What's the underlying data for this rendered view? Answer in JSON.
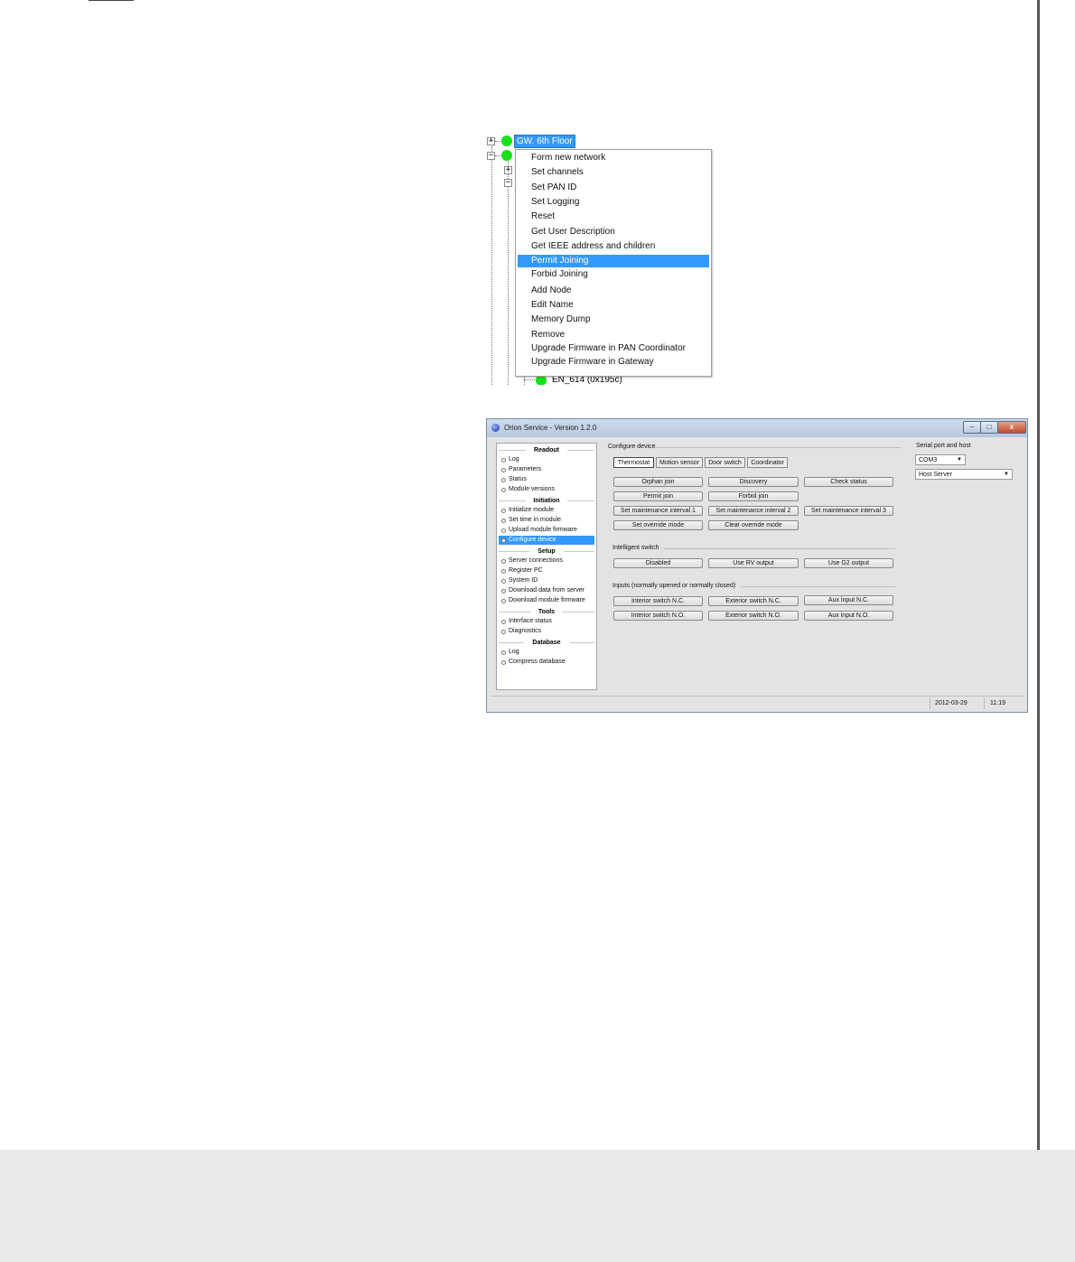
{
  "tree": {
    "gateway_label": "GW. 6th Floor",
    "en_label": "EN_614 (0x195c)"
  },
  "context_menu": {
    "items": [
      "Form new network",
      "Set channels",
      "Set PAN ID",
      "Set Logging",
      "Reset",
      "Get User Description",
      "Get IEEE address and children",
      "Permit Joining",
      "Forbid Joining",
      "Add Node",
      "Edit Name",
      "Memory Dump",
      "Remove",
      "Upgrade Firmware in PAN Coordinator",
      "Upgrade Firmware in Gateway"
    ],
    "selected": "Permit Joining"
  },
  "window": {
    "title": "Orion Service - Version 1.2.0",
    "buttons": {
      "minimize": "–",
      "maximize": "□",
      "close": "x"
    }
  },
  "nav": {
    "sections": [
      {
        "heading": "Readout",
        "items": [
          "Log",
          "Parameters",
          "Status",
          "Module versions"
        ]
      },
      {
        "heading": "Initiation",
        "items": [
          "Initialize module",
          "Set time in module",
          "Upload module firmware",
          "Configure device"
        ]
      },
      {
        "heading": "Setup",
        "items": [
          "Server connections",
          "Register PC",
          "System ID",
          "Download data from server",
          "Download module firmware"
        ]
      },
      {
        "heading": "Tools",
        "items": [
          "Interface status",
          "Diagnostics"
        ]
      },
      {
        "heading": "Database",
        "items": [
          "Log",
          "Compress database"
        ]
      }
    ],
    "selected": "Configure device"
  },
  "configure": {
    "title": "Configure device",
    "tabs": [
      "Thermostat",
      "Motion sensor",
      "Door switch",
      "Coordinator"
    ],
    "active_tab": "Thermostat",
    "buttons": {
      "orphan_join": "Orphan join",
      "discovery": "Discovery",
      "check_status": "Check status",
      "permit_join": "Permit join",
      "forbid_join": "Forbid join",
      "maint1": "Set maintenance interval 1",
      "maint2": "Set maintenance interval 2",
      "maint3": "Set maintenance interval 3",
      "set_override": "Set override mode",
      "clear_override": "Clear override mode"
    }
  },
  "intelligent_switch": {
    "title": "Intelligent switch",
    "buttons": {
      "disabled": "Disabled",
      "rv": "Use RV output",
      "g2": "Use G2 output"
    }
  },
  "inputs": {
    "title": "Inputs (normally opened or normally closed)",
    "buttons": {
      "int_nc": "Interior switch N.C.",
      "ext_nc": "Exterior switch N.C.",
      "aux_nc": "Aux input N.C.",
      "int_no": "Interior switch N.O.",
      "ext_no": "Exterior switch N.O.",
      "aux_no": "Aux input N.O."
    }
  },
  "serial": {
    "title": "Serial port and host",
    "port": "COM3",
    "host": "Host Server"
  },
  "status": {
    "date": "2012-03-29",
    "time": "11:19"
  }
}
